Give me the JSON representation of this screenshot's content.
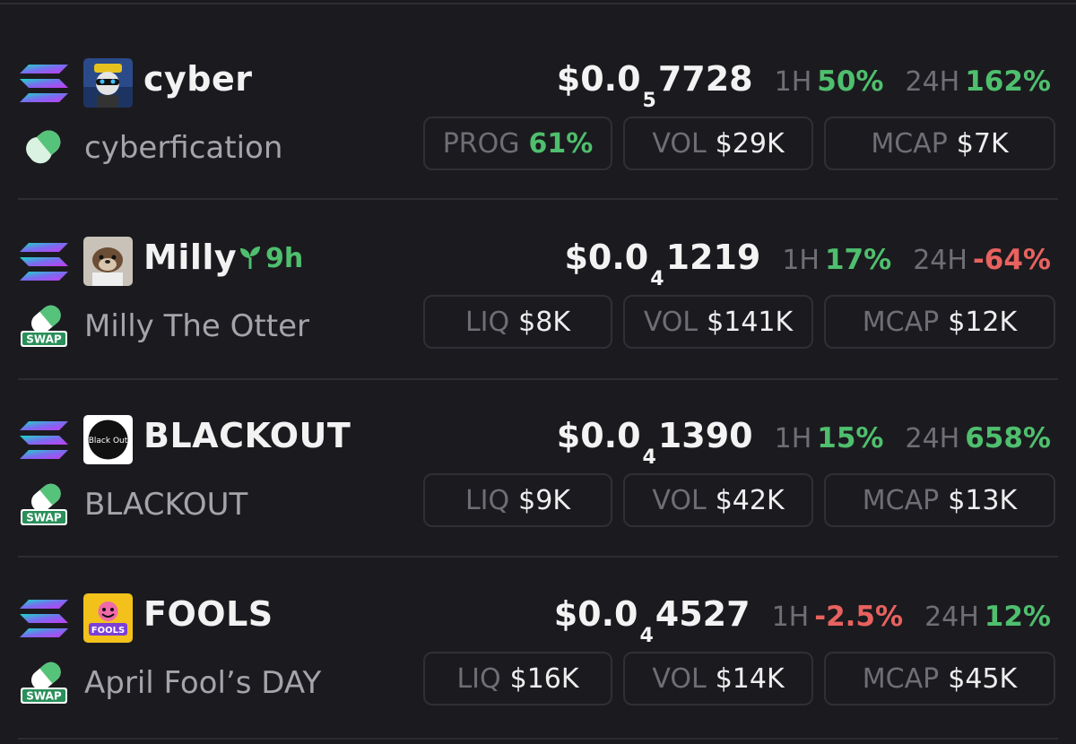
{
  "tokens": [
    {
      "ticker": "cyber",
      "age": "",
      "name": "cyberfication",
      "platform_icon": "pill-icon",
      "avatar_icon": "avatar-cyber",
      "price": {
        "prefix": "$0.0",
        "sub": "5",
        "digits": "7728"
      },
      "h1_label": "1H",
      "h1": "50%",
      "h24_label": "24H",
      "h24": "162%",
      "stat1": {
        "label": "PROG",
        "value": "61%"
      },
      "stat2": {
        "label": "VOL",
        "value": "$29K"
      },
      "stat3": {
        "label": "MCAP",
        "value": "$7K"
      }
    },
    {
      "ticker": "Milly",
      "age": "9h",
      "name": "Milly The Otter",
      "platform_icon": "swap-icon",
      "avatar_icon": "avatar-otter",
      "price": {
        "prefix": "$0.0",
        "sub": "4",
        "digits": "1219"
      },
      "h1_label": "1H",
      "h1": "17%",
      "h24_label": "24H",
      "h24": "-64%",
      "stat1": {
        "label": "LIQ",
        "value": "$8K"
      },
      "stat2": {
        "label": "VOL",
        "value": "$141K"
      },
      "stat3": {
        "label": "MCAP",
        "value": "$12K"
      }
    },
    {
      "ticker": "BLACKOUT",
      "age": "",
      "name": "BLACKOUT",
      "platform_icon": "swap-icon",
      "avatar_icon": "avatar-blackout",
      "avatar_text": "Black Out",
      "price": {
        "prefix": "$0.0",
        "sub": "4",
        "digits": "1390"
      },
      "h1_label": "1H",
      "h1": "15%",
      "h24_label": "24H",
      "h24": "658%",
      "stat1": {
        "label": "LIQ",
        "value": "$9K"
      },
      "stat2": {
        "label": "VOL",
        "value": "$42K"
      },
      "stat3": {
        "label": "MCAP",
        "value": "$13K"
      }
    },
    {
      "ticker": "FOOLS",
      "age": "",
      "name": "April Fool’s DAY",
      "platform_icon": "swap-icon",
      "avatar_icon": "avatar-fools",
      "avatar_text": "FOOLS",
      "price": {
        "prefix": "$0.0",
        "sub": "4",
        "digits": "4527"
      },
      "h1_label": "1H",
      "h1": "-2.5%",
      "h24_label": "24H",
      "h24": "12%",
      "stat1": {
        "label": "LIQ",
        "value": "$16K"
      },
      "stat2": {
        "label": "VOL",
        "value": "$14K"
      },
      "stat3": {
        "label": "MCAP",
        "value": "$45K"
      }
    }
  ],
  "swap_badge_text": "SWAP",
  "chain_icon": "solana-icon",
  "sprout_icon": "sprout-icon",
  "colors": {
    "background": "#1b1b1f",
    "positive": "#4fbf6e",
    "negative": "#e8625f",
    "muted": "#6e6e75",
    "pill_border": "#2f2f35"
  }
}
